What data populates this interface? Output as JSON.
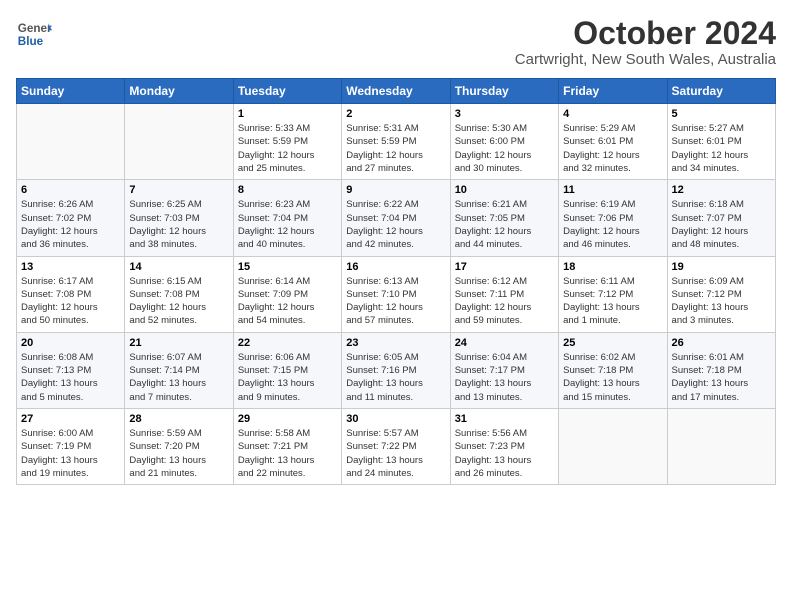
{
  "logo": {
    "line1": "General",
    "line2": "Blue"
  },
  "title": "October 2024",
  "subtitle": "Cartwright, New South Wales, Australia",
  "days_header": [
    "Sunday",
    "Monday",
    "Tuesday",
    "Wednesday",
    "Thursday",
    "Friday",
    "Saturday"
  ],
  "weeks": [
    [
      {
        "day": "",
        "info": ""
      },
      {
        "day": "",
        "info": ""
      },
      {
        "day": "1",
        "info": "Sunrise: 5:33 AM\nSunset: 5:59 PM\nDaylight: 12 hours\nand 25 minutes."
      },
      {
        "day": "2",
        "info": "Sunrise: 5:31 AM\nSunset: 5:59 PM\nDaylight: 12 hours\nand 27 minutes."
      },
      {
        "day": "3",
        "info": "Sunrise: 5:30 AM\nSunset: 6:00 PM\nDaylight: 12 hours\nand 30 minutes."
      },
      {
        "day": "4",
        "info": "Sunrise: 5:29 AM\nSunset: 6:01 PM\nDaylight: 12 hours\nand 32 minutes."
      },
      {
        "day": "5",
        "info": "Sunrise: 5:27 AM\nSunset: 6:01 PM\nDaylight: 12 hours\nand 34 minutes."
      }
    ],
    [
      {
        "day": "6",
        "info": "Sunrise: 6:26 AM\nSunset: 7:02 PM\nDaylight: 12 hours\nand 36 minutes."
      },
      {
        "day": "7",
        "info": "Sunrise: 6:25 AM\nSunset: 7:03 PM\nDaylight: 12 hours\nand 38 minutes."
      },
      {
        "day": "8",
        "info": "Sunrise: 6:23 AM\nSunset: 7:04 PM\nDaylight: 12 hours\nand 40 minutes."
      },
      {
        "day": "9",
        "info": "Sunrise: 6:22 AM\nSunset: 7:04 PM\nDaylight: 12 hours\nand 42 minutes."
      },
      {
        "day": "10",
        "info": "Sunrise: 6:21 AM\nSunset: 7:05 PM\nDaylight: 12 hours\nand 44 minutes."
      },
      {
        "day": "11",
        "info": "Sunrise: 6:19 AM\nSunset: 7:06 PM\nDaylight: 12 hours\nand 46 minutes."
      },
      {
        "day": "12",
        "info": "Sunrise: 6:18 AM\nSunset: 7:07 PM\nDaylight: 12 hours\nand 48 minutes."
      }
    ],
    [
      {
        "day": "13",
        "info": "Sunrise: 6:17 AM\nSunset: 7:08 PM\nDaylight: 12 hours\nand 50 minutes."
      },
      {
        "day": "14",
        "info": "Sunrise: 6:15 AM\nSunset: 7:08 PM\nDaylight: 12 hours\nand 52 minutes."
      },
      {
        "day": "15",
        "info": "Sunrise: 6:14 AM\nSunset: 7:09 PM\nDaylight: 12 hours\nand 54 minutes."
      },
      {
        "day": "16",
        "info": "Sunrise: 6:13 AM\nSunset: 7:10 PM\nDaylight: 12 hours\nand 57 minutes."
      },
      {
        "day": "17",
        "info": "Sunrise: 6:12 AM\nSunset: 7:11 PM\nDaylight: 12 hours\nand 59 minutes."
      },
      {
        "day": "18",
        "info": "Sunrise: 6:11 AM\nSunset: 7:12 PM\nDaylight: 13 hours\nand 1 minute."
      },
      {
        "day": "19",
        "info": "Sunrise: 6:09 AM\nSunset: 7:12 PM\nDaylight: 13 hours\nand 3 minutes."
      }
    ],
    [
      {
        "day": "20",
        "info": "Sunrise: 6:08 AM\nSunset: 7:13 PM\nDaylight: 13 hours\nand 5 minutes."
      },
      {
        "day": "21",
        "info": "Sunrise: 6:07 AM\nSunset: 7:14 PM\nDaylight: 13 hours\nand 7 minutes."
      },
      {
        "day": "22",
        "info": "Sunrise: 6:06 AM\nSunset: 7:15 PM\nDaylight: 13 hours\nand 9 minutes."
      },
      {
        "day": "23",
        "info": "Sunrise: 6:05 AM\nSunset: 7:16 PM\nDaylight: 13 hours\nand 11 minutes."
      },
      {
        "day": "24",
        "info": "Sunrise: 6:04 AM\nSunset: 7:17 PM\nDaylight: 13 hours\nand 13 minutes."
      },
      {
        "day": "25",
        "info": "Sunrise: 6:02 AM\nSunset: 7:18 PM\nDaylight: 13 hours\nand 15 minutes."
      },
      {
        "day": "26",
        "info": "Sunrise: 6:01 AM\nSunset: 7:18 PM\nDaylight: 13 hours\nand 17 minutes."
      }
    ],
    [
      {
        "day": "27",
        "info": "Sunrise: 6:00 AM\nSunset: 7:19 PM\nDaylight: 13 hours\nand 19 minutes."
      },
      {
        "day": "28",
        "info": "Sunrise: 5:59 AM\nSunset: 7:20 PM\nDaylight: 13 hours\nand 21 minutes."
      },
      {
        "day": "29",
        "info": "Sunrise: 5:58 AM\nSunset: 7:21 PM\nDaylight: 13 hours\nand 22 minutes."
      },
      {
        "day": "30",
        "info": "Sunrise: 5:57 AM\nSunset: 7:22 PM\nDaylight: 13 hours\nand 24 minutes."
      },
      {
        "day": "31",
        "info": "Sunrise: 5:56 AM\nSunset: 7:23 PM\nDaylight: 13 hours\nand 26 minutes."
      },
      {
        "day": "",
        "info": ""
      },
      {
        "day": "",
        "info": ""
      }
    ]
  ]
}
